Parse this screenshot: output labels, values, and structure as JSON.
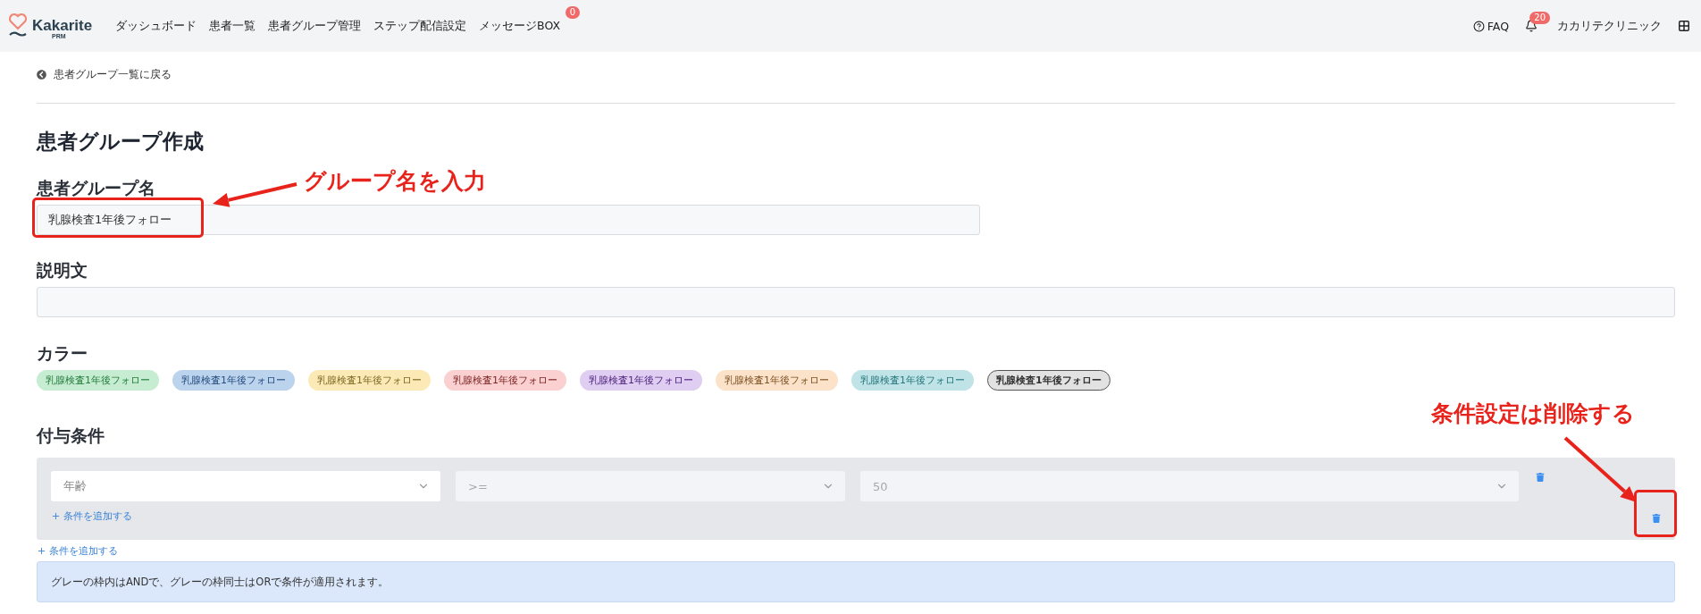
{
  "header": {
    "logo": {
      "name": "Kakarite",
      "sub": "PRM"
    },
    "nav": [
      {
        "label": "ダッシュボード"
      },
      {
        "label": "患者一覧"
      },
      {
        "label": "患者グループ管理"
      },
      {
        "label": "ステップ配信設定"
      },
      {
        "label": "メッセージBOX",
        "badge": "0"
      }
    ],
    "faq": "FAQ",
    "notification_badge": "20",
    "clinic": "カカリテクリニック"
  },
  "back_link": "患者グループ一覧に戻る",
  "title": "患者グループ作成",
  "name_field": {
    "label": "患者グループ名",
    "value": "乳腺検査1年後フォロー"
  },
  "description_field": {
    "label": "説明文"
  },
  "color": {
    "label": "カラー",
    "chips": [
      {
        "label": "乳腺検査1年後フォロー",
        "color": "#c6ecd1",
        "selected": false
      },
      {
        "label": "乳腺検査1年後フォロー",
        "color": "#bcd3ee",
        "selected": false
      },
      {
        "label": "乳腺検査1年後フォロー",
        "color": "#fbeab5",
        "selected": false
      },
      {
        "label": "乳腺検査1年後フォロー",
        "color": "#fbd0d0",
        "selected": false
      },
      {
        "label": "乳腺検査1年後フォロー",
        "color": "#dfcdf2",
        "selected": false
      },
      {
        "label": "乳腺検査1年後フォロー",
        "color": "#fbe2c8",
        "selected": false
      },
      {
        "label": "乳腺検査1年後フォロー",
        "color": "#bfe3e6",
        "selected": false
      },
      {
        "label": "乳腺検査1年後フォロー",
        "color": "#e2e2e2",
        "selected": true
      }
    ]
  },
  "conditions": {
    "label": "付与条件",
    "groups": [
      {
        "selects": [
          {
            "value": "年齢",
            "disabled": false
          },
          {
            "value": ">=",
            "disabled": true
          },
          {
            "value": "50",
            "disabled": true
          }
        ],
        "add_label": "条件を追加する"
      }
    ],
    "add_label": "条件を追加する"
  },
  "info": "グレーの枠内はANDで、グレーの枠同士はORで条件が適用されます。",
  "annotations": [
    {
      "kind": "name-field",
      "text": "グループ名を入力"
    },
    {
      "kind": "delete-button",
      "text": "条件設定は削除する"
    }
  ]
}
